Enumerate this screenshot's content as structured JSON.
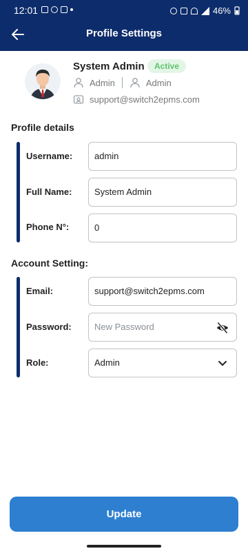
{
  "status_bar": {
    "time": "12:01",
    "battery": "46%"
  },
  "app_bar": {
    "title": "Profile Settings",
    "back_icon": "back-arrow-icon"
  },
  "profile": {
    "name": "System Admin",
    "status_badge": "Active",
    "role_primary": "Admin",
    "role_secondary": "Admin",
    "email": "support@switch2epms.com"
  },
  "profile_details": {
    "title": "Profile details",
    "fields": [
      {
        "label": "Username:",
        "value": "admin"
      },
      {
        "label": "Full Name:",
        "value": "System Admin"
      },
      {
        "label": "Phone N°:",
        "value": "0"
      }
    ]
  },
  "account_setting": {
    "title": "Account Setting:",
    "email_label": "Email:",
    "email_value": "support@switch2epms.com",
    "password_label": "Password:",
    "password_placeholder": "New Password",
    "role_label": "Role:",
    "role_value": "Admin"
  },
  "actions": {
    "update_label": "Update"
  },
  "colors": {
    "primary": "#0d2c6b",
    "button": "#2e7fd0",
    "badge_bg": "#e3f6e6",
    "badge_text": "#5fc26f"
  }
}
